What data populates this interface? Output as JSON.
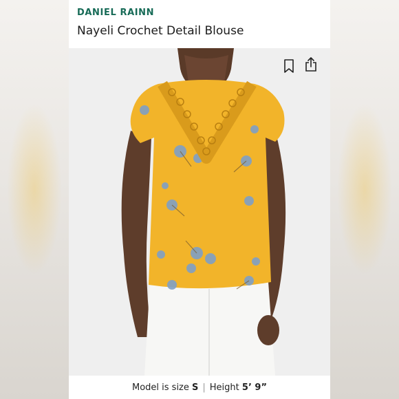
{
  "listing": {
    "brand": "DANIEL RAINN",
    "title": "Nayeli Crochet Detail Blouse"
  },
  "caption": {
    "size_label": "Model is size",
    "size_value": "S",
    "height_label": "Height",
    "height_value": "5’ 9”"
  },
  "icons": {
    "bookmark": "bookmark-icon",
    "share": "share-icon"
  },
  "colors": {
    "brand": "#176b57",
    "blouse": "#f2b42a",
    "flower": "#7fa0c6"
  }
}
